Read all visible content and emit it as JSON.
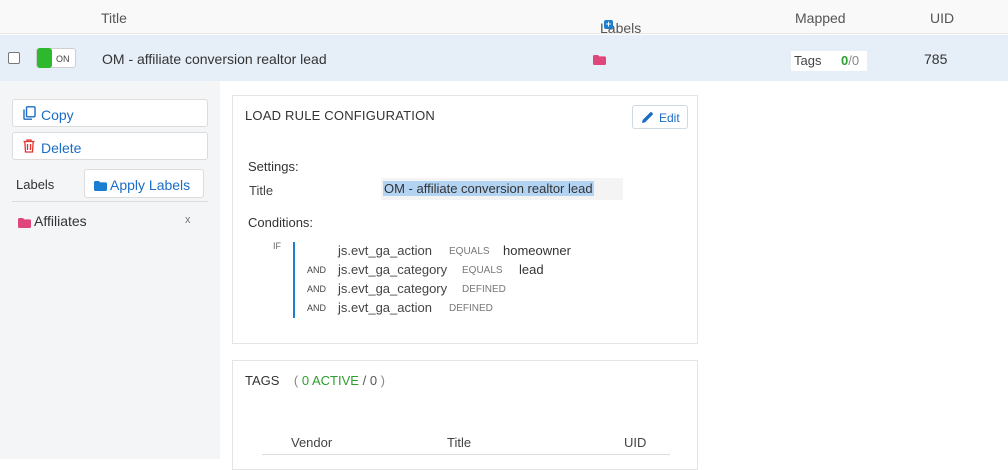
{
  "table": {
    "headers": {
      "title": "Title",
      "labels": "Labels",
      "mapped": "Mapped",
      "uid": "UID"
    },
    "row": {
      "toggle_label": "ON",
      "title": "OM - affiliate conversion realtor lead",
      "tags_label": "Tags",
      "tags_active": "0",
      "tags_sep": "/",
      "tags_total": "0",
      "uid": "785"
    }
  },
  "sidebar": {
    "copy_label": "Copy",
    "delete_label": "Delete",
    "labels_heading": "Labels",
    "apply_labels_label": "Apply Labels",
    "labels": [
      {
        "name": "Affiliates",
        "remove": "x"
      }
    ]
  },
  "config": {
    "heading": "LOAD RULE CONFIGURATION",
    "edit_label": "Edit",
    "settings_heading": "Settings:",
    "title_label": "Title",
    "title_value": "OM - affiliate conversion realtor lead",
    "conditions_heading": "Conditions:",
    "if_label": "IF",
    "conditions": [
      {
        "joiner": "",
        "variable": "js.evt_ga_action",
        "operator": "EQUALS",
        "value": "homeowner"
      },
      {
        "joiner": "AND",
        "variable": "js.evt_ga_category",
        "operator": "EQUALS",
        "value": "lead"
      },
      {
        "joiner": "AND",
        "variable": "js.evt_ga_category",
        "operator": "DEFINED",
        "value": ""
      },
      {
        "joiner": "AND",
        "variable": "js.evt_ga_action",
        "operator": "DEFINED",
        "value": ""
      }
    ]
  },
  "tags_panel": {
    "heading": "TAGS",
    "open_paren": "(",
    "active": "0 ACTIVE",
    "slash": "/",
    "total": "0",
    "close_paren": ")",
    "columns": {
      "vendor": "Vendor",
      "title": "Title",
      "uid": "UID"
    }
  },
  "colors": {
    "accent": "#1b6cc4",
    "toggle_on": "#2eb82e",
    "label_folder": "#e0457b",
    "selection": "#b3d3f3"
  }
}
